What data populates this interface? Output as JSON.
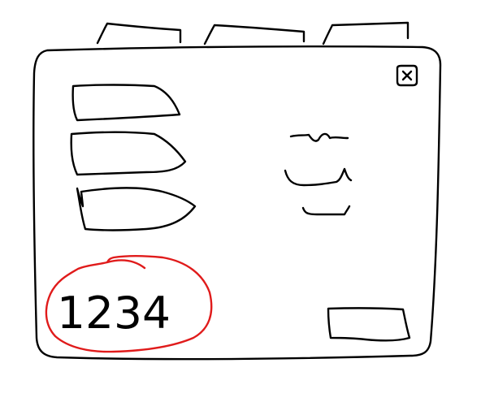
{
  "window": {
    "tabs": [
      {},
      {},
      {}
    ],
    "close_icon": "close-icon",
    "menu_buttons": [
      {},
      {},
      {}
    ],
    "side_text_lines": [
      {},
      {},
      {}
    ],
    "counter": {
      "value": "1234",
      "highlight_color": "#e01b1b"
    },
    "action_button": {}
  },
  "colors": {
    "ink": "#000000",
    "highlight": "#e01b1b",
    "background": "#ffffff"
  }
}
